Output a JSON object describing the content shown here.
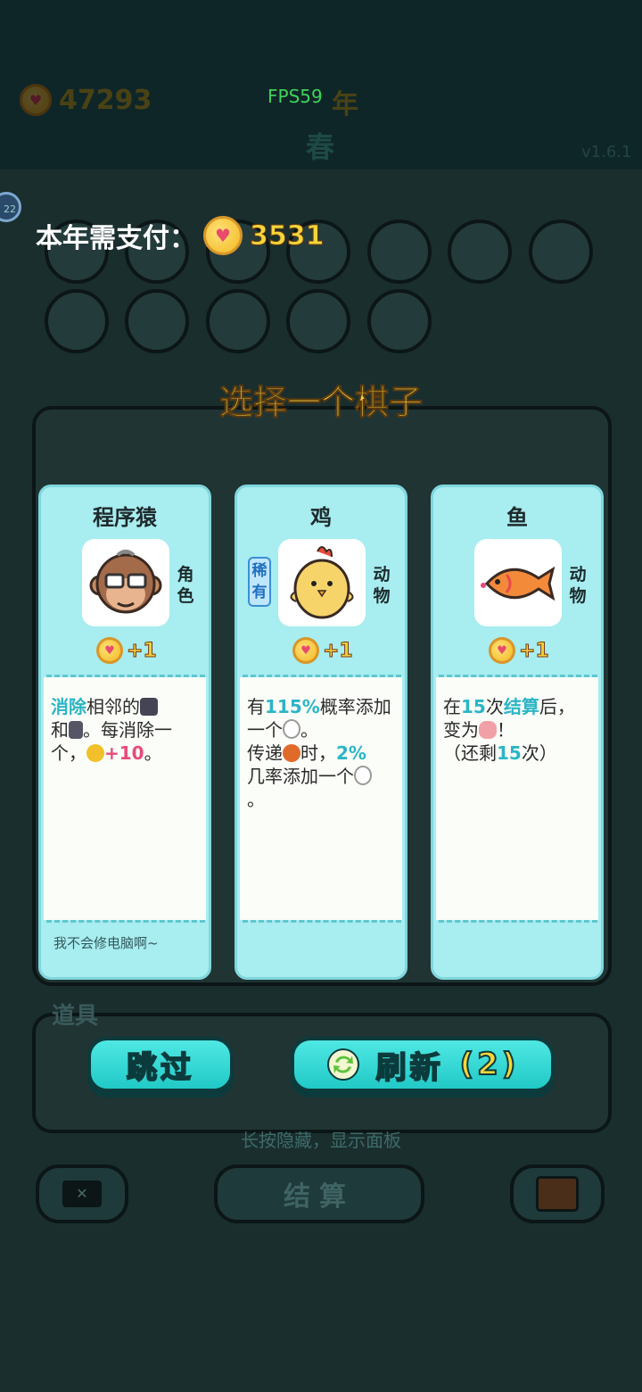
{
  "hud": {
    "coins": "47293",
    "fps": "FPS59",
    "season_top": "年",
    "season": "春",
    "version": "v1.6.1",
    "round_badge": "22"
  },
  "payment": {
    "label": "本年需支付：",
    "amount": "3531"
  },
  "dialog_title": "选择一个棋子",
  "cards": [
    {
      "name": "程序猿",
      "tag": "角色",
      "rare": "",
      "cost": "+1",
      "desc": {
        "hl": "消除",
        "t1": "相邻的",
        "t2": "和",
        "t3": "。每消除一个，",
        "reward": "+10",
        "t4": "。"
      },
      "flavor": "我不会修电脑啊~"
    },
    {
      "name": "鸡",
      "tag": "动物",
      "rare": "稀有",
      "cost": "+1",
      "desc": {
        "t1": "有",
        "p1": "115%",
        "t2": "概率添加一个",
        "t3": "。",
        "t4": "传递",
        "t5": "时，",
        "p2": "2%",
        "t6": "几率添加一个",
        "t7": "。"
      },
      "flavor": ""
    },
    {
      "name": "鱼",
      "tag": "动物",
      "rare": "",
      "cost": "+1",
      "desc": {
        "t1": "在",
        "n1": "15",
        "t2": "次",
        "hl": "结算",
        "t3": "后，变为",
        "t4": "！",
        "t5": "（还剩",
        "n2": "15",
        "t6": "次）"
      },
      "flavor": ""
    }
  ],
  "items_label": "道具",
  "buttons": {
    "skip": "跳过",
    "refresh": "刷新",
    "refresh_count": "(2)",
    "settle": "结算"
  },
  "hint": "长按隐藏，显示面板",
  "colors": {
    "accent": "#2bb5c6",
    "highlight": "#e84a7a",
    "button": "#33dad6"
  }
}
